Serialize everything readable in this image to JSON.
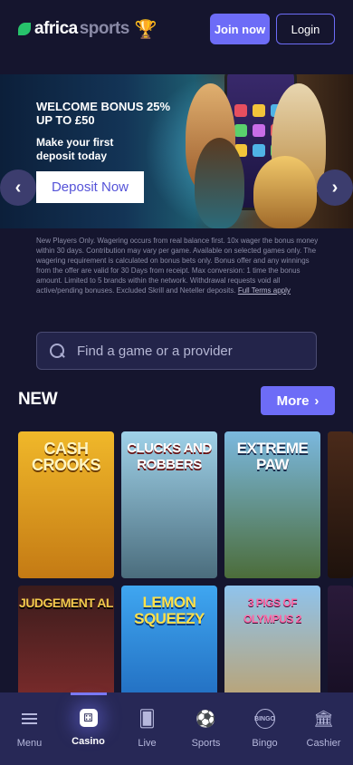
{
  "header": {
    "logo_africa": "africa",
    "logo_sports": "sports",
    "join_label": "Join now",
    "login_label": "Login"
  },
  "banner": {
    "title": "WELCOME BONUS 25% UP TO £50",
    "subtitle": "Make your first deposit today",
    "deposit_label": "Deposit Now",
    "prev_glyph": "‹",
    "next_glyph": "›"
  },
  "terms": {
    "text": "New Players Only. Wagering occurs from real balance first. 10x wager the bonus money within 30 days. Contribution may vary per game. Available on selected games only. The wagering requirement is calculated on bonus bets only. Bonus offer and any winnings from the offer are valid for 30 Days from receipt. Max conversion: 1 time the bonus amount. Limited to 5 brands within the network. Withdrawal requests void all active/pending bonuses. Excluded Skrill and Neteller deposits.",
    "link": "Full Terms apply"
  },
  "search": {
    "placeholder": "Find a game or a provider"
  },
  "new_section": {
    "title": "NEW",
    "more_label": "More",
    "games": [
      {
        "title": "CASH CROOKS",
        "bg1": "#f0b82a",
        "bg2": "#c47a14"
      },
      {
        "title": "CLUCKS AND ROBBERS",
        "bg1": "#9fd1e8",
        "bg2": "#4b6d7d"
      },
      {
        "title": "EXTREME PAW",
        "bg1": "#7bb8df",
        "bg2": "#4c6d3a"
      },
      {
        "title": "JUDGEMENT AL",
        "bg1": "#3a1c1c",
        "bg2": "#8c2f2f"
      },
      {
        "title": "LEMON SQUEEZY",
        "bg1": "#3fa6f0",
        "bg2": "#1a5fb4"
      },
      {
        "title": "3 PIGS OF OLYMPUS 2",
        "bg1": "#8fc3ec",
        "bg2": "#c79a52"
      }
    ]
  },
  "nav": {
    "items": [
      {
        "label": "Menu",
        "icon": "menu-icon"
      },
      {
        "label": "Casino",
        "icon": "dice-icon"
      },
      {
        "label": "Live",
        "icon": "cards-icon"
      },
      {
        "label": "Sports",
        "icon": "football-icon"
      },
      {
        "label": "Bingo",
        "icon": "bingo-icon"
      },
      {
        "label": "Cashier",
        "icon": "cashier-icon"
      }
    ],
    "active": "Casino"
  },
  "colors": {
    "background": "#15152e",
    "accent": "#6d6cf7",
    "nav_bg": "#272856"
  }
}
